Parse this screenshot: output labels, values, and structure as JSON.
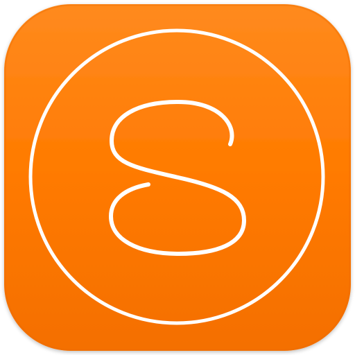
{
  "app_icon": {
    "name": "S",
    "glyph_icon": "letter-s-in-circle-icon",
    "colors": {
      "background_top": "#FF8A1E",
      "background": "#FF7A00",
      "background_bottom": "#F46F00",
      "edge_shadow": "#E86A00",
      "outer_backdrop": "#FFFFFF",
      "stroke": "#FFFFFF"
    }
  }
}
